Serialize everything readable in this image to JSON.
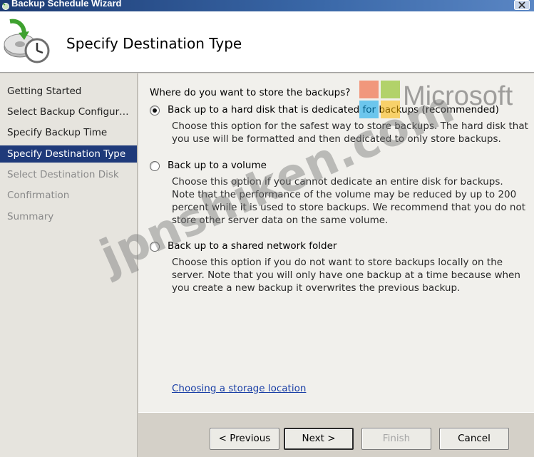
{
  "window": {
    "title": "Backup Schedule Wizard"
  },
  "header": {
    "title": "Specify Destination Type",
    "icon": "backup-clock-icon"
  },
  "steps": [
    {
      "label": "Getting Started",
      "state": "done"
    },
    {
      "label": "Select Backup Configur…",
      "state": "done"
    },
    {
      "label": "Specify Backup Time",
      "state": "done"
    },
    {
      "label": "Specify Destination Type",
      "state": "active"
    },
    {
      "label": "Select Destination Disk",
      "state": "future"
    },
    {
      "label": "Confirmation",
      "state": "future"
    },
    {
      "label": "Summary",
      "state": "future"
    }
  ],
  "content": {
    "question": "Where do you want to store the backups?",
    "options": [
      {
        "label": "Back up to a hard disk that is dedicated for backups (recommended)",
        "description": "Choose this option for the safest way to store backups. The hard disk that you use will be formatted and then dedicated to only store backups.",
        "selected": true
      },
      {
        "label": "Back up to a volume",
        "description": "Choose this option if you cannot dedicate an entire disk for backups. Note that the performance of the volume may be reduced by up to 200 percent while it is used to store backups. We recommend that you do not store other server data on the same volume.",
        "selected": false
      },
      {
        "label": "Back up to a shared network folder",
        "description": "Choose this option if you do not want to store backups locally on the server. Note that you will only have one backup at a time because when you create a new backup it overwrites the previous backup.",
        "selected": false
      }
    ],
    "link": "Choosing a storage location"
  },
  "buttons": {
    "previous": "< Previous",
    "next": "Next >",
    "finish": "Finish",
    "cancel": "Cancel"
  },
  "watermark": {
    "brand": "Microsoft",
    "site": "jpnshiken.com"
  },
  "colors": {
    "accent": "#1f3a7a",
    "link": "#1a3fa6"
  }
}
